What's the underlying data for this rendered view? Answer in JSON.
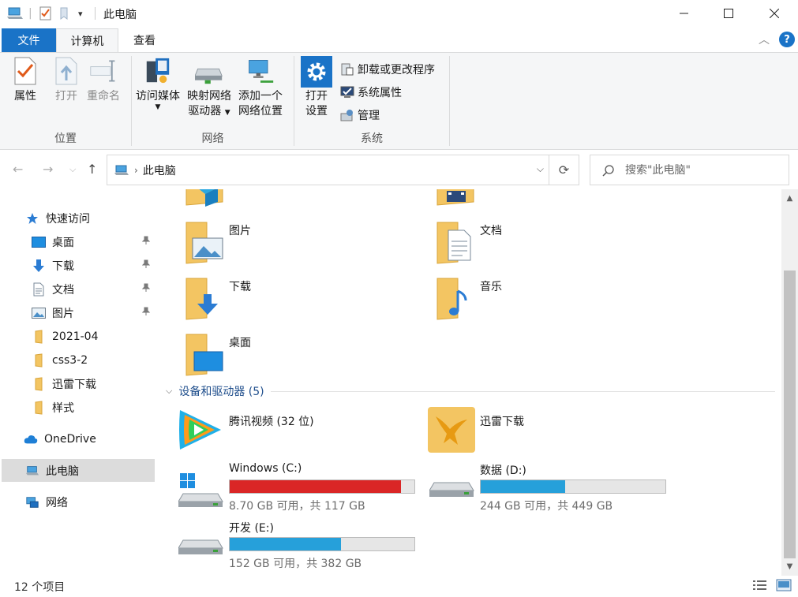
{
  "window": {
    "title": "此电脑",
    "minimize_icon": "minimize-icon",
    "maximize_icon": "maximize-icon",
    "close_icon": "close-icon"
  },
  "ribbon_tabs": {
    "file": "文件",
    "computer": "计算机",
    "view": "查看"
  },
  "ribbon": {
    "location_group": {
      "label": "位置",
      "properties": "属性",
      "open": "打开",
      "rename": "重命名"
    },
    "network_group": {
      "label": "网络",
      "access_media": "访问媒体",
      "map_drive_line1": "映射网络",
      "map_drive_line2": "驱动器",
      "add_location_line1": "添加一个",
      "add_location_line2": "网络位置"
    },
    "system_group": {
      "label": "系统",
      "open_settings_line1": "打开",
      "open_settings_line2": "设置",
      "uninstall": "卸载或更改程序",
      "system_properties": "系统属性",
      "manage": "管理"
    }
  },
  "address": {
    "path": "此电脑",
    "search_placeholder": "搜索\"此电脑\""
  },
  "sidebar": {
    "quick_access": "快速访问",
    "items": [
      {
        "label": "桌面"
      },
      {
        "label": "下载"
      },
      {
        "label": "文档"
      },
      {
        "label": "图片"
      },
      {
        "label": "2021-04"
      },
      {
        "label": "css3-2"
      },
      {
        "label": "迅雷下载"
      },
      {
        "label": "样式"
      }
    ],
    "onedrive": "OneDrive",
    "this_pc": "此电脑",
    "network": "网络"
  },
  "folders": [
    {
      "name": "图片"
    },
    {
      "name": "文档"
    },
    {
      "name": "下载"
    },
    {
      "name": "音乐"
    },
    {
      "name": "桌面"
    }
  ],
  "devices_section": "设备和驱动器 (5)",
  "devices": [
    {
      "name": "腾讯视频 (32 位)"
    },
    {
      "name": "迅雷下载"
    }
  ],
  "drives": [
    {
      "name": "Windows (C:)",
      "space": "8.70 GB 可用，共 117 GB",
      "used_fraction": 0.926,
      "color": "#da2626"
    },
    {
      "name": "数据 (D:)",
      "space": "244 GB 可用，共 449 GB",
      "used_fraction": 0.457,
      "color": "#26a0da"
    },
    {
      "name": "开发 (E:)",
      "space": "152 GB 可用，共 382 GB",
      "used_fraction": 0.602,
      "color": "#26a0da"
    }
  ],
  "status": {
    "item_count": "12 个项目"
  },
  "colors": {
    "accent": "#1a73c7",
    "folder": "#f3c562",
    "drive_bar_normal": "#26a0da",
    "drive_bar_full": "#da2626"
  }
}
